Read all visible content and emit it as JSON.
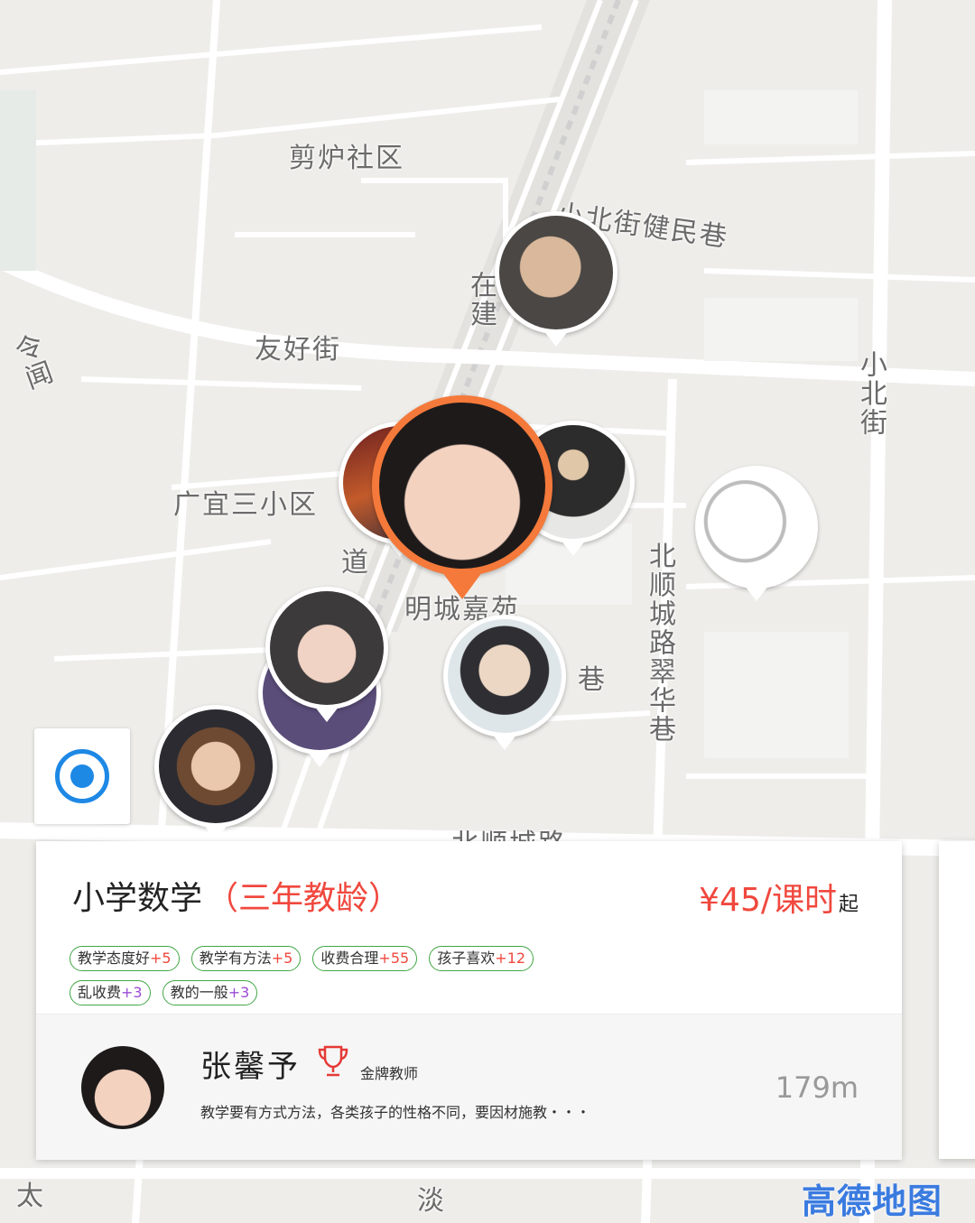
{
  "map": {
    "labels": {
      "jianlu": "剪炉社区",
      "xiaobeijie_jianmin": "小北街健民巷",
      "youhaojie": "友好街",
      "zaijian": "在建",
      "road_dao": "道",
      "guangyi": "广宜三小区",
      "mingcheng": "明城嘉苑",
      "xiang": "巷",
      "xiaobeijie": "小北街",
      "beishun_cuihua": "北顺城路翠华巷",
      "beishunchenglu": "北顺城路",
      "lingwen": "令闻",
      "tai": "太",
      "dan": "淡"
    }
  },
  "card": {
    "subject": "小学数学",
    "experience": "（三年教龄）",
    "price": "¥45/课时",
    "price_suffix": "起",
    "tags": [
      {
        "label": "教学态度好",
        "score": "+5"
      },
      {
        "label": "教学有方法",
        "score": "+5"
      },
      {
        "label": "收费合理",
        "score": "+55"
      },
      {
        "label": "孩子喜欢",
        "score": "+12"
      },
      {
        "label": "乱收费",
        "score": "+3"
      },
      {
        "label": "教的一般",
        "score": "+3"
      }
    ],
    "teacher": {
      "name": "张馨予",
      "rank": "金牌教师",
      "description": "教学要有方式方法，各类孩子的性格不同，要因材施教・・・",
      "distance": "179m"
    }
  },
  "logo": "高德地图"
}
